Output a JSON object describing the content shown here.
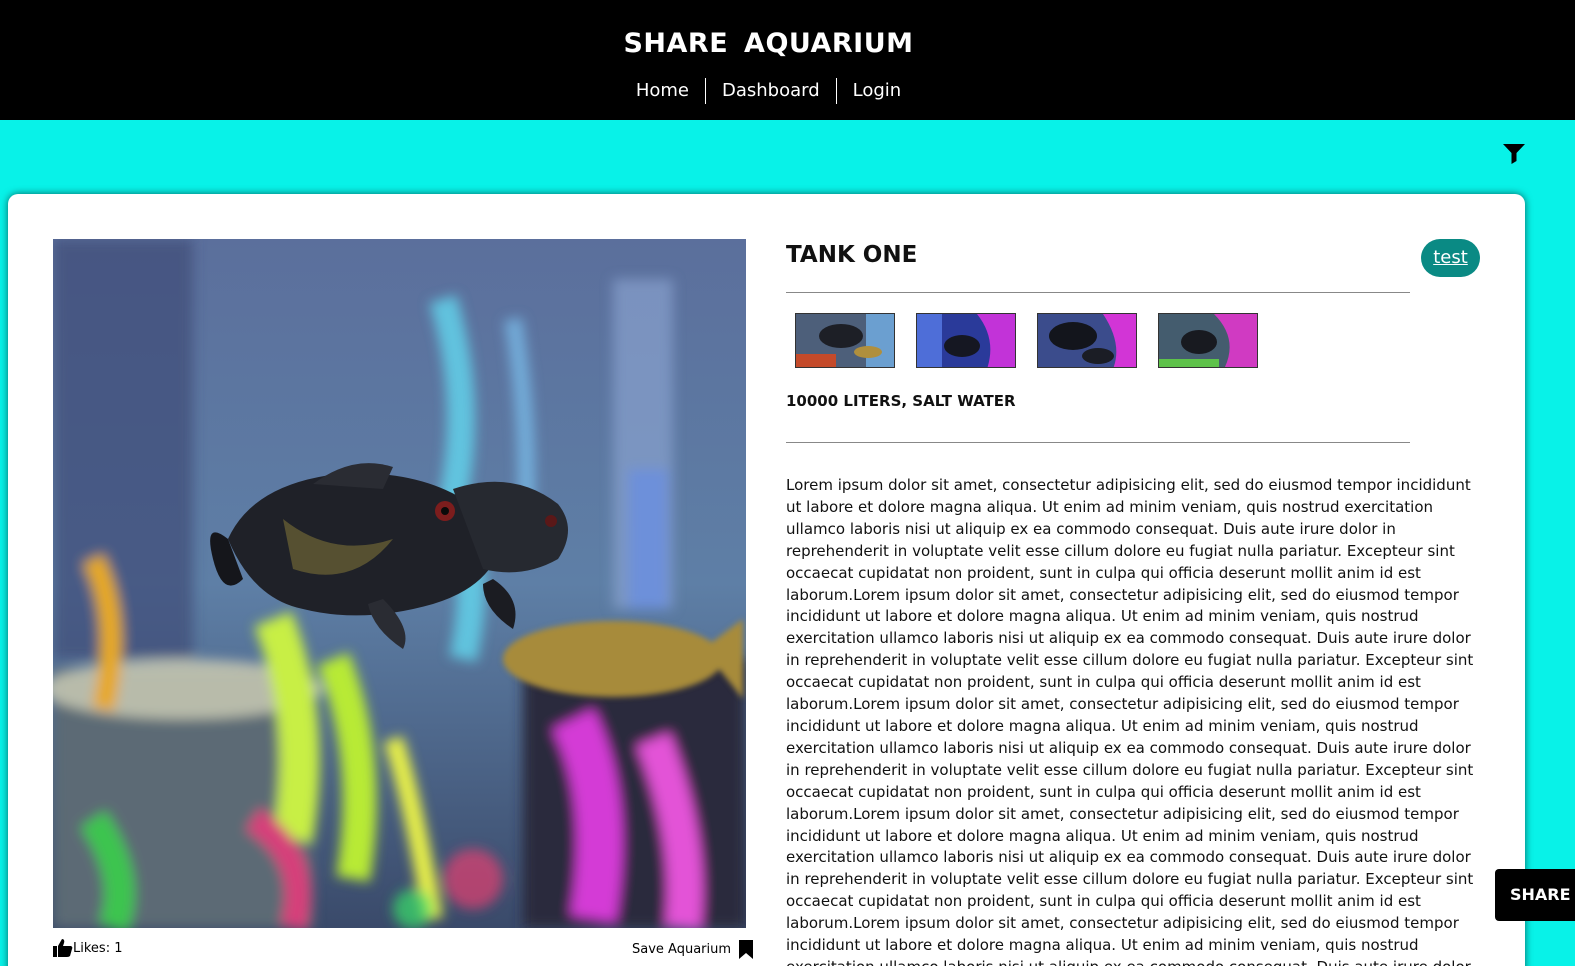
{
  "header": {
    "site_title": "SHARE  AQUARIUM",
    "nav": [
      {
        "label": "Home"
      },
      {
        "label": "Dashboard"
      },
      {
        "label": "Login"
      }
    ]
  },
  "toolbar": {
    "filter_icon": "filter-icon"
  },
  "tank": {
    "title": "TANK ONE",
    "user_tag": "test",
    "specs": "10000 LITERS, SALT WATER",
    "description": "Lorem ipsum dolor sit amet, consectetur adipisicing elit, sed do eiusmod tempor incididunt ut labore et dolore magna aliqua. Ut enim ad minim veniam, quis nostrud exercitation ullamco laboris nisi ut aliquip ex ea commodo consequat. Duis aute irure dolor in reprehenderit in voluptate velit esse cillum dolore eu fugiat nulla pariatur. Excepteur sint occaecat cupidatat non proident, sunt in culpa qui officia deserunt mollit anim id est laborum.Lorem ipsum dolor sit amet, consectetur adipisicing elit, sed do eiusmod tempor incididunt ut labore et dolore magna aliqua. Ut enim ad minim veniam, quis nostrud exercitation ullamco laboris nisi ut aliquip ex ea commodo consequat. Duis aute irure dolor in reprehenderit in voluptate velit esse cillum dolore eu fugiat nulla pariatur. Excepteur sint occaecat cupidatat non proident, sunt in culpa qui officia deserunt mollit anim id est laborum.Lorem ipsum dolor sit amet, consectetur adipisicing elit, sed do eiusmod tempor incididunt ut labore et dolore magna aliqua. Ut enim ad minim veniam, quis nostrud exercitation ullamco laboris nisi ut aliquip ex ea commodo consequat. Duis aute irure dolor in reprehenderit in voluptate velit esse cillum dolore eu fugiat nulla pariatur. Excepteur sint occaecat cupidatat non proident, sunt in culpa qui officia deserunt mollit anim id est laborum.Lorem ipsum dolor sit amet, consectetur adipisicing elit, sed do eiusmod tempor incididunt ut labore et dolore magna aliqua. Ut enim ad minim veniam, quis nostrud exercitation ullamco laboris nisi ut aliquip ex ea commodo consequat. Duis aute irure dolor in reprehenderit in voluptate velit esse cillum dolore eu fugiat nulla pariatur. Excepteur sint occaecat cupidatat non proident, sunt in culpa qui officia deserunt mollit anim id est laborum.Lorem ipsum dolor sit amet, consectetur adipisicing elit, sed do eiusmod tempor incididunt ut labore et dolore magna aliqua. Ut enim ad minim veniam, quis nostrud exercitation ullamco laboris nisi ut aliquip ex ea commodo consequat. Duis aute irure dolor in reprehenderit in voluptate velit esse cillum",
    "likes_label": "Likes: 1",
    "save_label": "Save Aquarium"
  },
  "share_tab": {
    "label": "SHARE Y"
  },
  "colors": {
    "page_bg": "#08f2e8",
    "header_bg": "#000000",
    "tag_bg": "#0a8a84"
  }
}
